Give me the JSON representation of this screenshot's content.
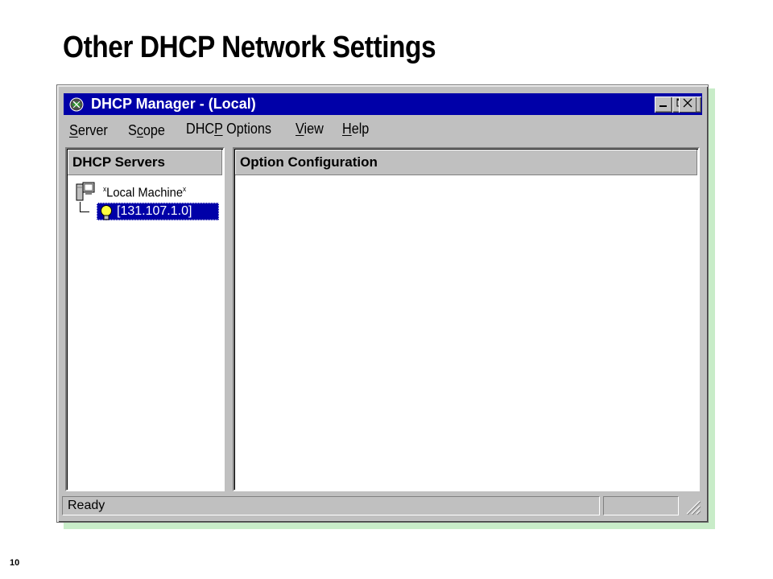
{
  "slide": {
    "title": "Other DHCP Network Settings",
    "page_number": "10"
  },
  "window": {
    "title": "DHCP Manager - (Local)",
    "controls": {
      "minimize": "minimize-icon",
      "maximize": "maximize-icon",
      "close": "close-icon"
    },
    "colors": {
      "titlebar": "#0000a8",
      "face": "#c0c0c0",
      "selection": "#0000a8"
    }
  },
  "menu": {
    "server": {
      "label": "Server",
      "underline": "S",
      "rest": "erver"
    },
    "scope": {
      "label": "Scope",
      "pre": "S",
      "underline": "c",
      "rest": "ope"
    },
    "dhcp_options": {
      "label": "DHCP Options",
      "pre": "DHC",
      "underline": "P",
      "rest": " Options"
    },
    "view": {
      "label": "View",
      "underline": "V",
      "rest": "iew"
    },
    "help": {
      "label": "Help",
      "underline": "H",
      "rest": "elp"
    }
  },
  "left_pane": {
    "header": "DHCP Servers",
    "tree": {
      "root": {
        "prefix": "x",
        "label": "Local Machine",
        "suffix": "x",
        "icon": "server-computer-icon"
      },
      "child": {
        "label": "[131.107.1.0]",
        "icon": "lightbulb-icon",
        "selected": true
      }
    }
  },
  "right_pane": {
    "header": "Option Configuration"
  },
  "status_bar": {
    "text": "Ready"
  }
}
